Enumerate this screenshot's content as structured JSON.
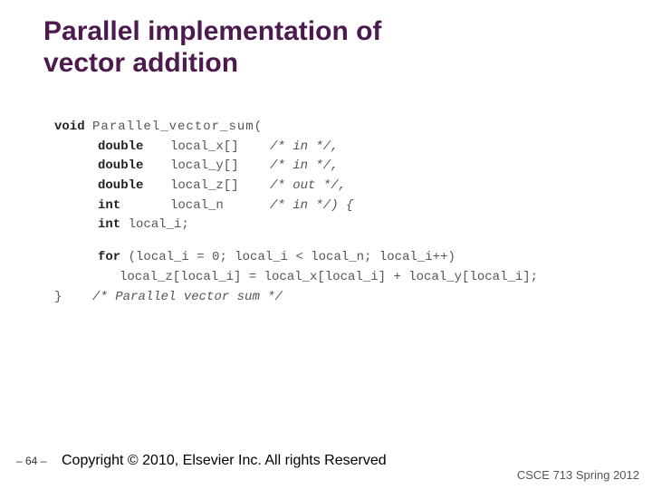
{
  "title_line1": "Parallel implementation of",
  "title_line2": "vector addition",
  "code": {
    "l1_kw": "void",
    "l1_fn": "Parallel_vector_sum(",
    "p1_type": "double",
    "p1_name": "local_x[]",
    "p1_cmt": "/* in  */,",
    "p2_type": "double",
    "p2_name": "local_y[]",
    "p2_cmt": "/* in  */,",
    "p3_type": "double",
    "p3_name": "local_z[]",
    "p3_cmt": "/* out */,",
    "p4_type": "int",
    "p4_name": "local_n",
    "p4_cmt": "/* in  */) {",
    "decl_kw": "int",
    "decl_name": "local_i;",
    "for_kw": "for",
    "for_cond": "(local_i = 0; local_i < local_n; local_i++)",
    "for_body": "local_z[local_i] = local_x[local_i] + local_y[local_i];",
    "close_brace": "}",
    "close_cmt": "/* Parallel vector sum */"
  },
  "footer": {
    "page": "– 64 –",
    "copyright": "Copyright © 2010, Elsevier Inc. All rights Reserved",
    "course": "CSCE 713 Spring 2012"
  }
}
